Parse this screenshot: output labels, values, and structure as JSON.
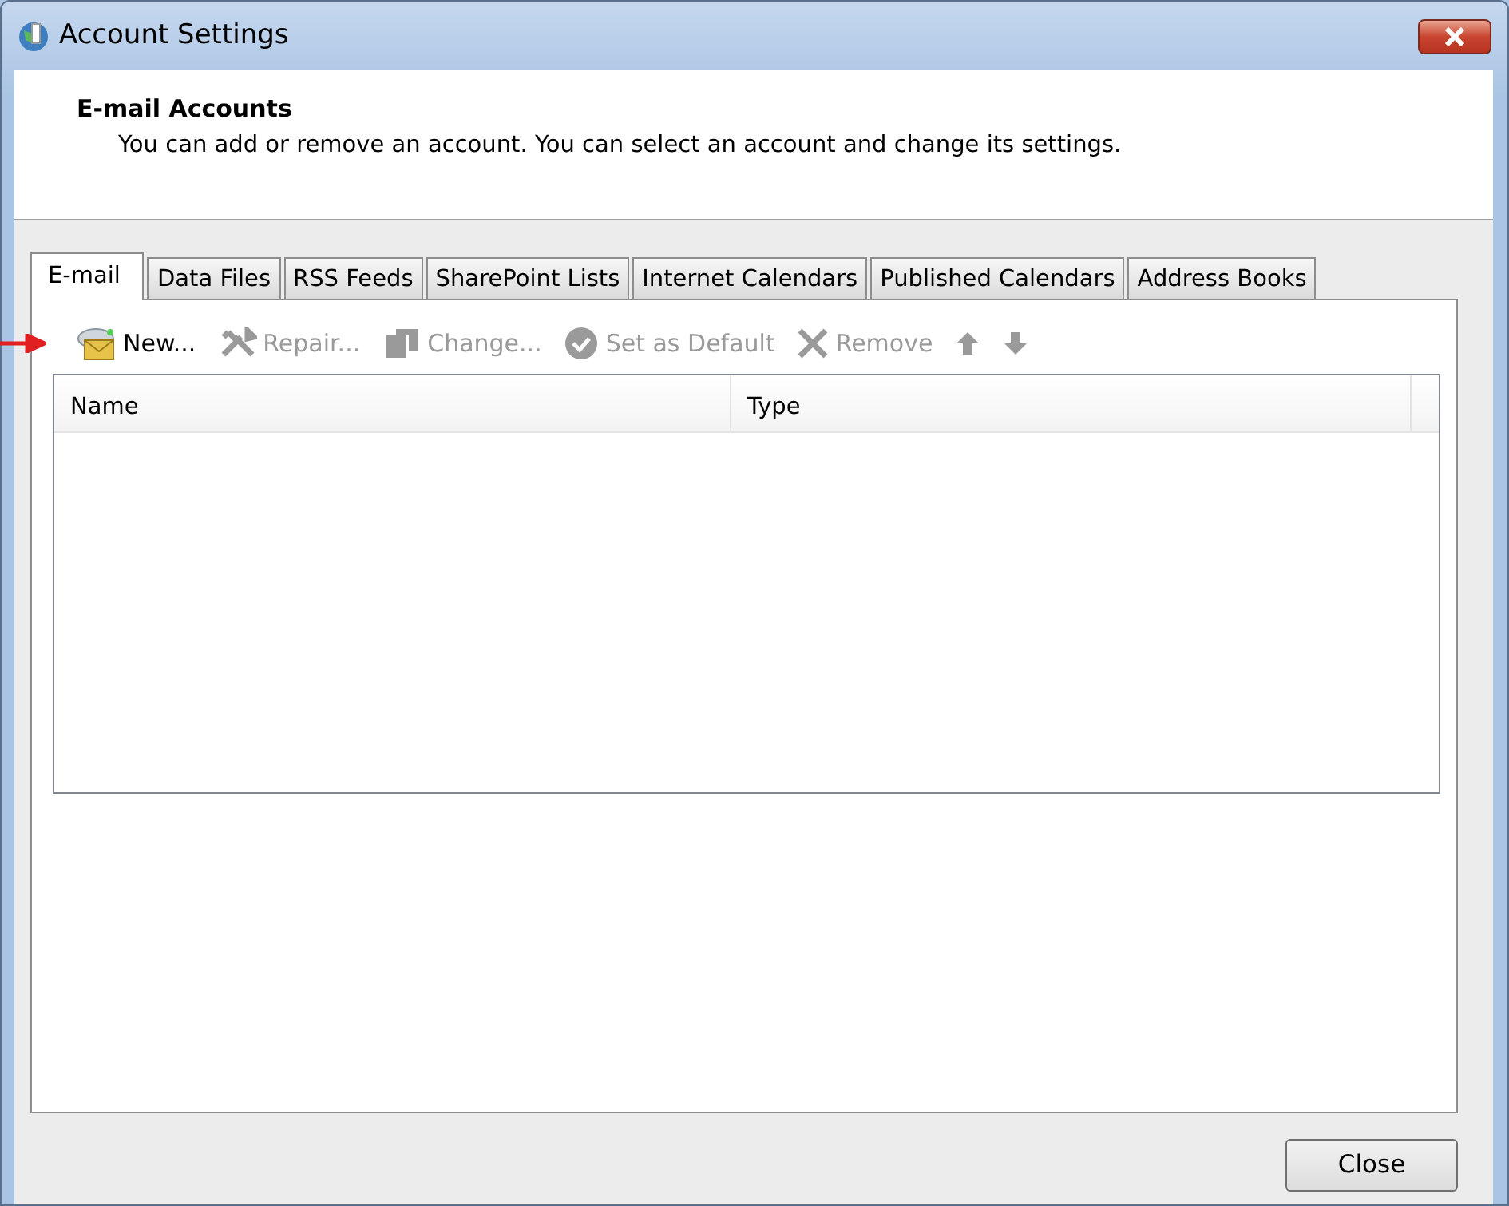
{
  "window": {
    "title": "Account Settings"
  },
  "header": {
    "heading": "E-mail Accounts",
    "description": "You can add or remove an account. You can select an account and change its settings."
  },
  "tabs": [
    {
      "label": "E-mail",
      "selected": true
    },
    {
      "label": "Data Files",
      "selected": false
    },
    {
      "label": "RSS Feeds",
      "selected": false
    },
    {
      "label": "SharePoint Lists",
      "selected": false
    },
    {
      "label": "Internet Calendars",
      "selected": false
    },
    {
      "label": "Published Calendars",
      "selected": false
    },
    {
      "label": "Address Books",
      "selected": false
    }
  ],
  "toolbar": [
    {
      "kind": "new",
      "label": "New...",
      "disabled": false
    },
    {
      "kind": "repair",
      "label": "Repair...",
      "disabled": true
    },
    {
      "kind": "change",
      "label": "Change...",
      "disabled": true
    },
    {
      "kind": "default",
      "label": "Set as Default",
      "disabled": true
    },
    {
      "kind": "remove",
      "label": "Remove",
      "disabled": true
    },
    {
      "kind": "up",
      "disabled": true
    },
    {
      "kind": "down",
      "disabled": true
    }
  ],
  "table": {
    "columns": [
      "Name",
      "Type"
    ]
  },
  "buttons": [
    "Close"
  ]
}
